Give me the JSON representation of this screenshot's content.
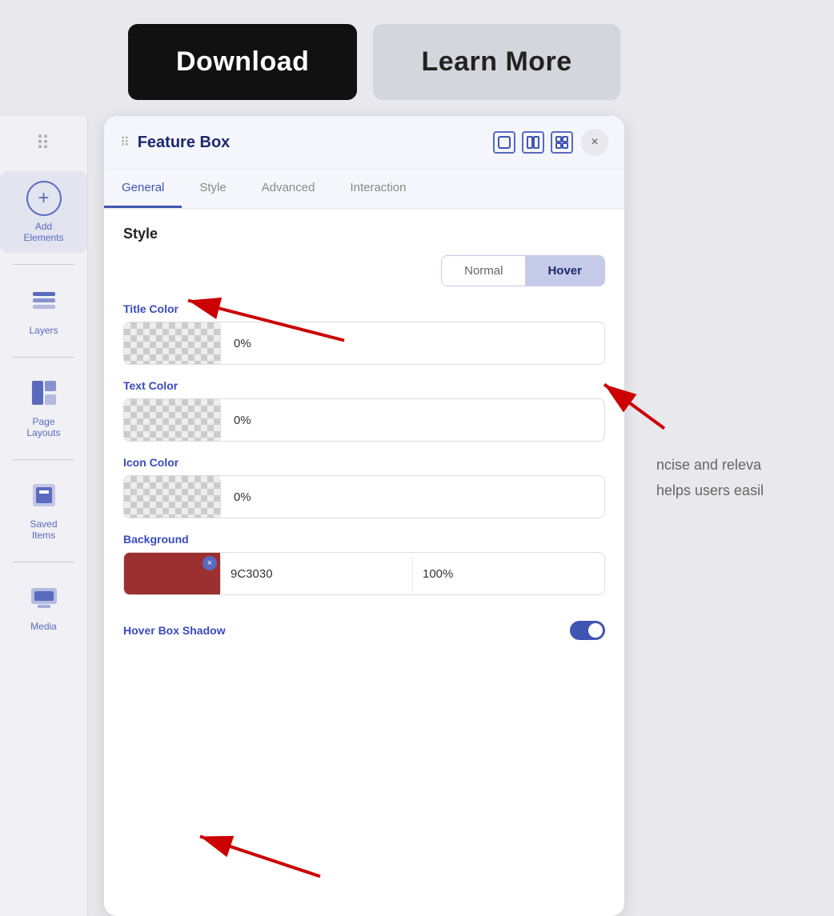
{
  "topbar": {
    "download_label": "Download",
    "learn_more_label": "Learn More"
  },
  "sidebar": {
    "dots": "⠿",
    "items": [
      {
        "id": "add-elements",
        "icon": "➕",
        "label": "Add Elements"
      },
      {
        "id": "layers",
        "icon": "layers",
        "label": "Layers"
      },
      {
        "id": "page-layouts",
        "icon": "layouts",
        "label": "Page Layouts"
      },
      {
        "id": "saved-items",
        "icon": "saved",
        "label": "Saved Items"
      },
      {
        "id": "media",
        "icon": "media",
        "label": "Media"
      }
    ]
  },
  "panel": {
    "title": "Feature Box",
    "close_label": "×",
    "tabs": [
      {
        "id": "general",
        "label": "General",
        "active": true
      },
      {
        "id": "style",
        "label": "Style",
        "active": false
      },
      {
        "id": "advanced",
        "label": "Advanced",
        "active": false
      },
      {
        "id": "interaction",
        "label": "Interaction",
        "active": false
      }
    ],
    "style_section": {
      "title": "Style",
      "toggle": {
        "normal": "Normal",
        "hover": "Hover"
      },
      "fields": [
        {
          "id": "title-color",
          "label": "Title Color",
          "has_color": false,
          "value": "0%"
        },
        {
          "id": "text-color",
          "label": "Text Color",
          "has_color": false,
          "value": "0%"
        },
        {
          "id": "icon-color",
          "label": "Icon Color",
          "has_color": false,
          "value": "0%"
        }
      ],
      "background": {
        "label": "Background",
        "hex": "9C3030",
        "opacity": "100%"
      },
      "hover_box_shadow": {
        "label": "Hover Box Shadow"
      }
    }
  },
  "right_content": {
    "line1": "ncise and releva",
    "line2": "helps users easil"
  }
}
